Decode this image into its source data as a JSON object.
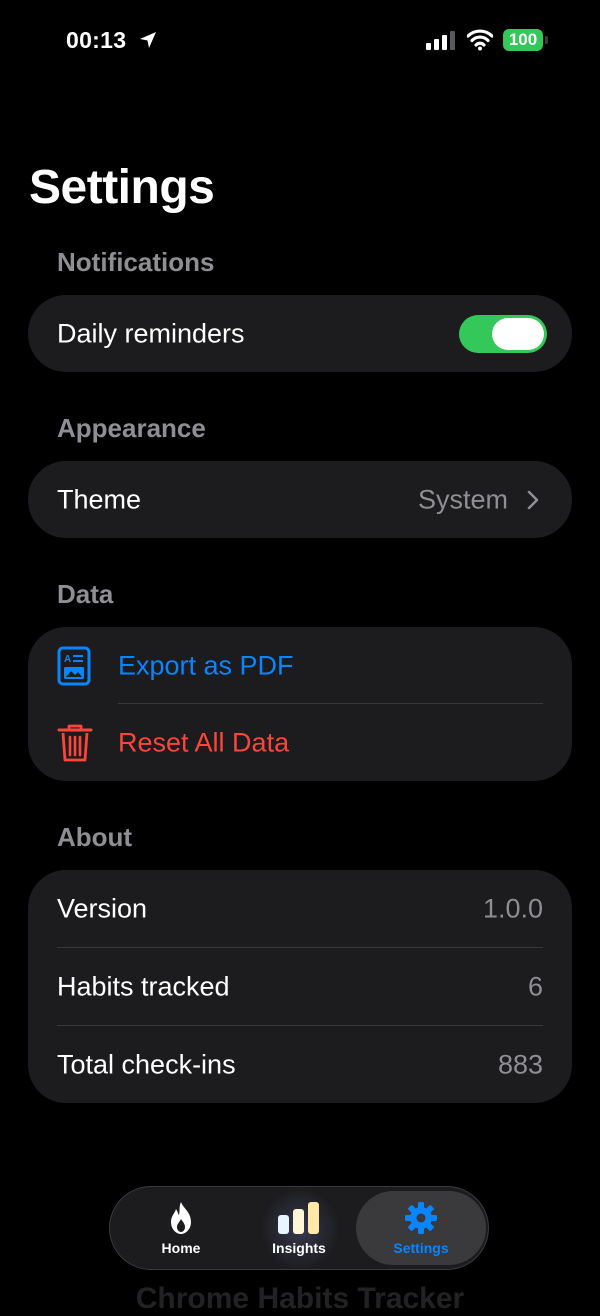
{
  "status_bar": {
    "time": "00:13",
    "battery": "100"
  },
  "page": {
    "title": "Settings"
  },
  "sections": {
    "notifications": {
      "header": "Notifications",
      "daily_reminders": {
        "label": "Daily reminders",
        "enabled": true
      }
    },
    "appearance": {
      "header": "Appearance",
      "theme": {
        "label": "Theme",
        "value": "System"
      }
    },
    "data": {
      "header": "Data",
      "export": {
        "label": "Export as PDF",
        "color": "#0a84ff"
      },
      "reset": {
        "label": "Reset All Data",
        "color": "#ff453a"
      }
    },
    "about": {
      "header": "About",
      "rows": [
        {
          "label": "Version",
          "value": "1.0.0"
        },
        {
          "label": "Habits tracked",
          "value": "6"
        },
        {
          "label": "Total check-ins",
          "value": "883"
        }
      ]
    }
  },
  "tab_bar": {
    "tabs": [
      {
        "label": "Home",
        "icon": "flame-icon"
      },
      {
        "label": "Insights",
        "icon": "bar-chart-icon"
      },
      {
        "label": "Settings",
        "icon": "gear-icon",
        "active": true
      }
    ],
    "active_color": "#0a84ff"
  },
  "footer": {
    "text": "Chrome Habits Tracker"
  },
  "colors": {
    "accent": "#0a84ff",
    "destructive": "#ff453a",
    "toggle_on": "#34c759"
  }
}
